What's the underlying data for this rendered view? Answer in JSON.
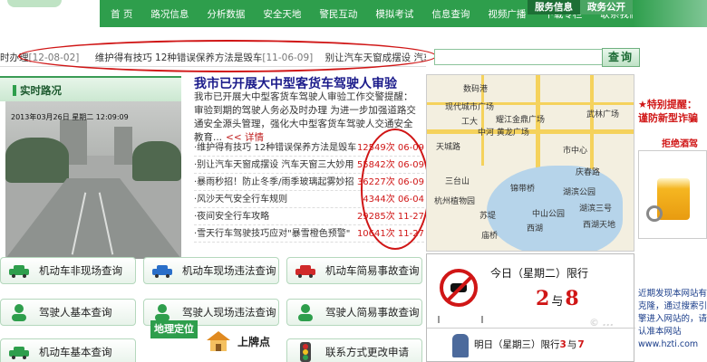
{
  "nav": {
    "items": [
      "首 页",
      "路况信息",
      "分析数据",
      "安全天地",
      "警民互动",
      "模拟考试",
      "信息查询",
      "视频广播",
      "下载专栏",
      "联系我们"
    ],
    "service_tabs": [
      "服务信息",
      "政务公开"
    ]
  },
  "ticker": {
    "items": [
      {
        "text": "时办理",
        "date": "[12-08-02]"
      },
      {
        "text": "维护得有技巧 12种错误保养方法是毁车",
        "date": "[11-06-09]"
      },
      {
        "text": "别让汽车天窗成摆设 汽车天窗三大妙",
        "date": ""
      }
    ]
  },
  "search": {
    "button": "查询",
    "placeholder": ""
  },
  "camera": {
    "title": "实时路况",
    "timestamp": "2013年03月26日 星期二 12:09:09"
  },
  "headline": {
    "title": "我市已开展大中型客货车驾驶人审验",
    "summary": "我市已开展大中型客货车驾驶人审验工作交警提醒：审验到期的驾驶人务必及时办理 为进一步加强道路交通安全源头管理，强化大中型客货车驾驶人交通安全教育...",
    "more": "<< 详情"
  },
  "news": [
    {
      "title": "·维护得有技巧 12种错误保养方法是毁车",
      "count": "12549次 06-09"
    },
    {
      "title": "·别让汽车天窗成摆设 汽车天窗三大妙用",
      "count": "55842次 06-09"
    },
    {
      "title": "·暴雨秒招！防止冬季/雨季玻璃起雾妙招",
      "count": "36227次 06-09"
    },
    {
      "title": "·风沙天气安全行车规则",
      "count": "4344次 06-04"
    },
    {
      "title": "·夜间安全行车攻略",
      "count": "29285次 11-27"
    },
    {
      "title": "·雪天行车驾驶技巧应对\"暴雪橙色预警\"",
      "count": "10641次 11-27"
    }
  ],
  "map": {
    "labels": [
      "数码港",
      "现代城市广场",
      "工大",
      "耀江金鼎广场",
      "武林广场",
      "中河 黄龙广场",
      "天城路",
      "市中心",
      "三台山",
      "庆春路",
      "湖滨公园",
      "杭州植物园",
      "锦带桥",
      "中山公园",
      "西湖",
      "苏堤",
      "庙桥",
      "湖滨三号",
      "西湖天地"
    ]
  },
  "promo": {
    "alert": "★特别提醒：",
    "alert2": "谨防新型诈骗",
    "drunk": "拒绝酒驾",
    "notice": "近期发现本网站有克隆，通过搜索引擎进入网站的，请认准本网站",
    "site": "www.hzti.com"
  },
  "queries": [
    {
      "label": "机动车非现场查询",
      "icon": "car-icon"
    },
    {
      "label": "机动车现场违法查询",
      "icon": "blue-car-icon"
    },
    {
      "label": "机动车简易事故查询",
      "icon": "red-car-icon"
    },
    {
      "label": "驾驶人基本查询",
      "icon": "person-icon"
    },
    {
      "label": "驾驶人现场违法查询",
      "icon": "person-icon"
    },
    {
      "label": "驾驶人简易事故查询",
      "icon": "person-icon"
    },
    {
      "label": "机动车基本查询",
      "icon": "car-icon"
    },
    {
      "label": "联系方式更改申请",
      "icon": "traffic-light-icon"
    }
  ],
  "geo": {
    "label": "地理定位"
  },
  "shangpai": {
    "label": "上牌点"
  },
  "restriction": {
    "today_label": "今日（星期二）限行",
    "today_a": "2",
    "today_b": "8",
    "yu": "与",
    "tomorrow_prefix": "明日（星期三）限行",
    "tomorrow_a": "3",
    "tomorrow_b": "7"
  },
  "watermark": "© ..."
}
